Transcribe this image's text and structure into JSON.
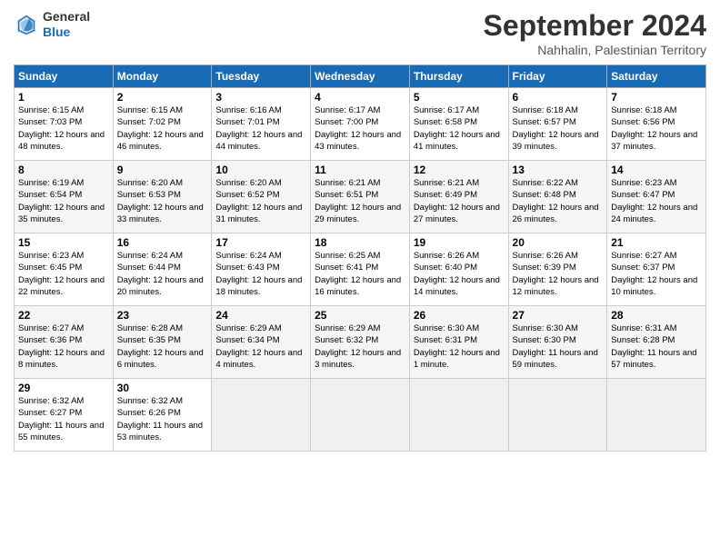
{
  "logo": {
    "general": "General",
    "blue": "Blue"
  },
  "title": "September 2024",
  "location": "Nahhalin, Palestinian Territory",
  "headers": [
    "Sunday",
    "Monday",
    "Tuesday",
    "Wednesday",
    "Thursday",
    "Friday",
    "Saturday"
  ],
  "weeks": [
    [
      {
        "day": "1",
        "sunrise": "6:15 AM",
        "sunset": "7:03 PM",
        "daylight": "12 hours and 48 minutes."
      },
      {
        "day": "2",
        "sunrise": "6:15 AM",
        "sunset": "7:02 PM",
        "daylight": "12 hours and 46 minutes."
      },
      {
        "day": "3",
        "sunrise": "6:16 AM",
        "sunset": "7:01 PM",
        "daylight": "12 hours and 44 minutes."
      },
      {
        "day": "4",
        "sunrise": "6:17 AM",
        "sunset": "7:00 PM",
        "daylight": "12 hours and 43 minutes."
      },
      {
        "day": "5",
        "sunrise": "6:17 AM",
        "sunset": "6:58 PM",
        "daylight": "12 hours and 41 minutes."
      },
      {
        "day": "6",
        "sunrise": "6:18 AM",
        "sunset": "6:57 PM",
        "daylight": "12 hours and 39 minutes."
      },
      {
        "day": "7",
        "sunrise": "6:18 AM",
        "sunset": "6:56 PM",
        "daylight": "12 hours and 37 minutes."
      }
    ],
    [
      {
        "day": "8",
        "sunrise": "6:19 AM",
        "sunset": "6:54 PM",
        "daylight": "12 hours and 35 minutes."
      },
      {
        "day": "9",
        "sunrise": "6:20 AM",
        "sunset": "6:53 PM",
        "daylight": "12 hours and 33 minutes."
      },
      {
        "day": "10",
        "sunrise": "6:20 AM",
        "sunset": "6:52 PM",
        "daylight": "12 hours and 31 minutes."
      },
      {
        "day": "11",
        "sunrise": "6:21 AM",
        "sunset": "6:51 PM",
        "daylight": "12 hours and 29 minutes."
      },
      {
        "day": "12",
        "sunrise": "6:21 AM",
        "sunset": "6:49 PM",
        "daylight": "12 hours and 27 minutes."
      },
      {
        "day": "13",
        "sunrise": "6:22 AM",
        "sunset": "6:48 PM",
        "daylight": "12 hours and 26 minutes."
      },
      {
        "day": "14",
        "sunrise": "6:23 AM",
        "sunset": "6:47 PM",
        "daylight": "12 hours and 24 minutes."
      }
    ],
    [
      {
        "day": "15",
        "sunrise": "6:23 AM",
        "sunset": "6:45 PM",
        "daylight": "12 hours and 22 minutes."
      },
      {
        "day": "16",
        "sunrise": "6:24 AM",
        "sunset": "6:44 PM",
        "daylight": "12 hours and 20 minutes."
      },
      {
        "day": "17",
        "sunrise": "6:24 AM",
        "sunset": "6:43 PM",
        "daylight": "12 hours and 18 minutes."
      },
      {
        "day": "18",
        "sunrise": "6:25 AM",
        "sunset": "6:41 PM",
        "daylight": "12 hours and 16 minutes."
      },
      {
        "day": "19",
        "sunrise": "6:26 AM",
        "sunset": "6:40 PM",
        "daylight": "12 hours and 14 minutes."
      },
      {
        "day": "20",
        "sunrise": "6:26 AM",
        "sunset": "6:39 PM",
        "daylight": "12 hours and 12 minutes."
      },
      {
        "day": "21",
        "sunrise": "6:27 AM",
        "sunset": "6:37 PM",
        "daylight": "12 hours and 10 minutes."
      }
    ],
    [
      {
        "day": "22",
        "sunrise": "6:27 AM",
        "sunset": "6:36 PM",
        "daylight": "12 hours and 8 minutes."
      },
      {
        "day": "23",
        "sunrise": "6:28 AM",
        "sunset": "6:35 PM",
        "daylight": "12 hours and 6 minutes."
      },
      {
        "day": "24",
        "sunrise": "6:29 AM",
        "sunset": "6:34 PM",
        "daylight": "12 hours and 4 minutes."
      },
      {
        "day": "25",
        "sunrise": "6:29 AM",
        "sunset": "6:32 PM",
        "daylight": "12 hours and 3 minutes."
      },
      {
        "day": "26",
        "sunrise": "6:30 AM",
        "sunset": "6:31 PM",
        "daylight": "12 hours and 1 minute."
      },
      {
        "day": "27",
        "sunrise": "6:30 AM",
        "sunset": "6:30 PM",
        "daylight": "11 hours and 59 minutes."
      },
      {
        "day": "28",
        "sunrise": "6:31 AM",
        "sunset": "6:28 PM",
        "daylight": "11 hours and 57 minutes."
      }
    ],
    [
      {
        "day": "29",
        "sunrise": "6:32 AM",
        "sunset": "6:27 PM",
        "daylight": "11 hours and 55 minutes."
      },
      {
        "day": "30",
        "sunrise": "6:32 AM",
        "sunset": "6:26 PM",
        "daylight": "11 hours and 53 minutes."
      },
      null,
      null,
      null,
      null,
      null
    ]
  ]
}
